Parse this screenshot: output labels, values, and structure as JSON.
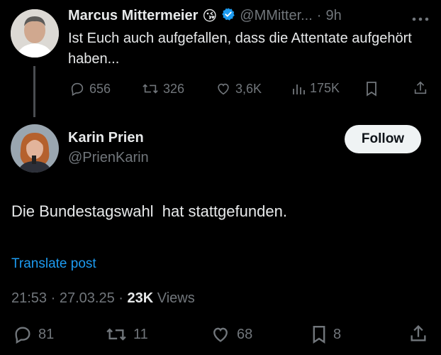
{
  "reply_tweet": {
    "author_name": "Marcus Mittermeier",
    "author_emoji": "😘",
    "author_handle": "@MMitter...",
    "separator": "·",
    "time": "9h",
    "text": "Ist Euch auch aufgefallen, dass die Attentate aufgehört haben...",
    "replies": "656",
    "reposts": "326",
    "likes": "3,6K",
    "views": "175K"
  },
  "main_tweet": {
    "author_name": "Karin Prien",
    "author_handle": "@PrienKarin",
    "follow_label": "Follow",
    "text": "Die Bundestagswahl  hat stattgefunden.",
    "translate_label": "Translate post",
    "time": "21:53",
    "date": "27.03.25",
    "views_count": "23K",
    "views_label": "Views",
    "replies": "81",
    "reposts": "11",
    "likes": "68",
    "bookmarks": "8"
  },
  "colors": {
    "background": "#000000",
    "text": "#e7e9ea",
    "muted": "#71767b",
    "accent": "#1d9bf0",
    "verified": "#1d9bf0"
  }
}
